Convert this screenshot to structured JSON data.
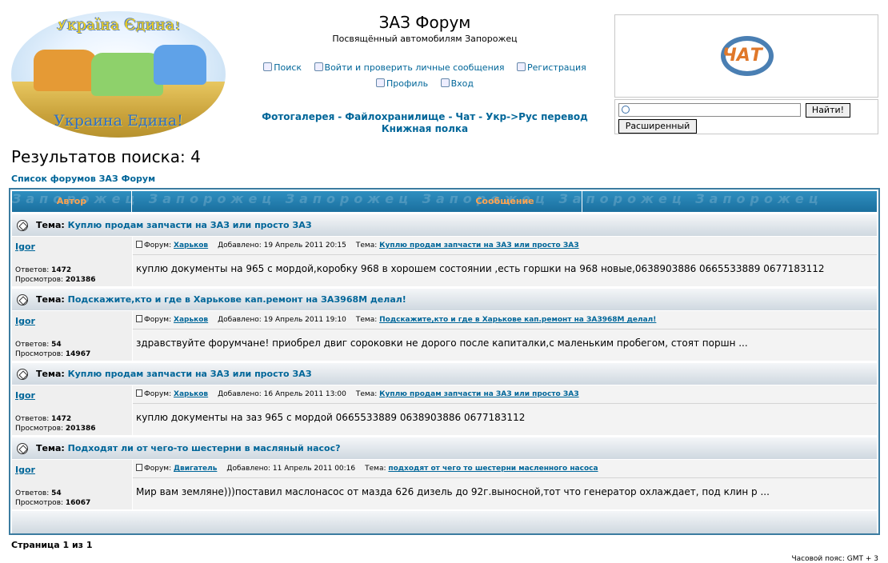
{
  "logo": {
    "slogan_top": "Україна Єдина!",
    "slogan_bottom": "Украина Едина!"
  },
  "header": {
    "title": "ЗАЗ Форум",
    "description": "Посвящённый автомобилям Запорожец",
    "nav1": [
      {
        "label": "Поиск",
        "icon": "search-icon"
      },
      {
        "label": "Войти и проверить личные сообщения",
        "icon": "messages-icon"
      },
      {
        "label": "Регистрация",
        "icon": "register-icon"
      }
    ],
    "nav2": [
      {
        "label": "Профиль",
        "icon": "profile-icon"
      },
      {
        "label": "Вход",
        "icon": "login-icon"
      }
    ],
    "links": [
      "Фотогалерея",
      "Файлохранилище",
      "Чат",
      "Укр->Рус перевод",
      "Книжная полка"
    ],
    "link_separator": "-"
  },
  "chat": {
    "logo_text": "ЧАТ"
  },
  "search": {
    "value": "",
    "find_label": "Найти!",
    "advanced_label": "Расширенный"
  },
  "results": {
    "title": "Результатов поиска: 4",
    "breadcrumb": "Список форумов ЗАЗ Форум"
  },
  "table": {
    "col_author": "Автор",
    "col_message": "Сообщение",
    "watermark": "Запорожец  Запорожец  Запорожец  Запорожец  Запорожец  Запорожец",
    "topic_prefix": "Тема:",
    "forum_prefix": "Форум:",
    "added_prefix": "Добавлено:",
    "subject_prefix": "Тема:",
    "replies_label": "Ответов:",
    "views_label": "Просмотров:"
  },
  "posts": [
    {
      "topic": "Куплю продам запчасти на ЗАЗ или просто ЗАЗ",
      "author": "Igor",
      "replies": "1472",
      "views": "201386",
      "forum": "Харьков",
      "added": "19 Апрель 2011 20:15",
      "subject": "Куплю продам запчасти на ЗАЗ или просто ЗАЗ",
      "body": "куплю документы на 965 с мордой,коробку 968 в хорошем состоянии ,есть горшки на 968 новые,0638903886 0665533889 0677183112"
    },
    {
      "topic": "Подскажите,кто и где в Харькове кап.ремонт на ЗАЗ968М делал!",
      "author": "Igor",
      "replies": "54",
      "views": "14967",
      "forum": "Харьков",
      "added": "19 Апрель 2011 19:10",
      "subject": "Подскажите,кто и где в Харькове кап.ремонт на ЗАЗ968М делал!",
      "body": "здравствуйте форумчане! приобрел двиг сороковки не дорого после капиталки,с маленьким пробегом, стоят поршн ..."
    },
    {
      "topic": "Куплю продам запчасти на ЗАЗ или просто ЗАЗ",
      "author": "Igor",
      "replies": "1472",
      "views": "201386",
      "forum": "Харьков",
      "added": "16 Апрель 2011 13:00",
      "subject": "Куплю продам запчасти на ЗАЗ или просто ЗАЗ",
      "body": "куплю документы на заз 965 с мордой 0665533889 0638903886 0677183112"
    },
    {
      "topic": "Подходят ли от чего-то шестерни в масляный насос?",
      "author": "Igor",
      "replies": "54",
      "views": "16067",
      "forum": "Двигатель",
      "added": "11 Апрель 2011 00:16",
      "subject": "подходят от чего то шестерни масленного насоса",
      "body": "Мир вам земляне)))поставил маслонасос от мазда 626 дизель до 92г.выносной,тот что генератор охлаждает, под клин р ..."
    }
  ],
  "footer": {
    "pages": "Страница 1 из 1",
    "timezone": "Часовой пояс: GMT + 3"
  }
}
